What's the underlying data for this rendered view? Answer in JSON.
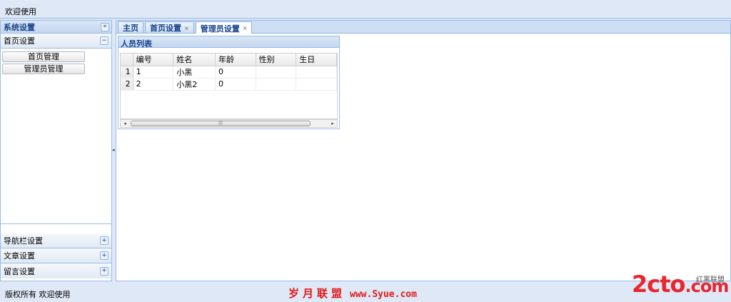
{
  "header": {
    "text": "欢迎使用"
  },
  "sidebar": {
    "title": "系统设置",
    "collapse_icon": "«",
    "sections": [
      {
        "label": "首页设置",
        "toggle": "−",
        "expanded": true,
        "items": [
          "首页管理",
          "管理员管理"
        ]
      },
      {
        "label": "导航栏设置",
        "toggle": "+"
      },
      {
        "label": "文章设置",
        "toggle": "+"
      },
      {
        "label": "留言设置",
        "toggle": "+"
      }
    ]
  },
  "tabs": [
    {
      "label": "主页"
    },
    {
      "label": "首页设置",
      "close": "×"
    },
    {
      "label": "管理员设置",
      "close": "×",
      "active": true
    }
  ],
  "grid": {
    "title": "人员列表",
    "columns": [
      "编号",
      "姓名",
      "年龄",
      "性别",
      "生日"
    ],
    "rows": [
      {
        "rn": "1",
        "cells": [
          "1",
          "小黑",
          "0",
          "",
          ""
        ]
      },
      {
        "rn": "2",
        "cells": [
          "2",
          "小黑2",
          "0",
          "",
          ""
        ]
      }
    ],
    "scroll_left": "◂",
    "scroll_right": "▸",
    "scroll_grip": "|||"
  },
  "footer": {
    "text": "版权所有 欢迎使用"
  },
  "watermark": {
    "text": "岁月联盟",
    "url": "www.Syue.com"
  },
  "logo": {
    "main": "2cto",
    "suffix": ".com",
    "cn": "红黑联盟"
  }
}
